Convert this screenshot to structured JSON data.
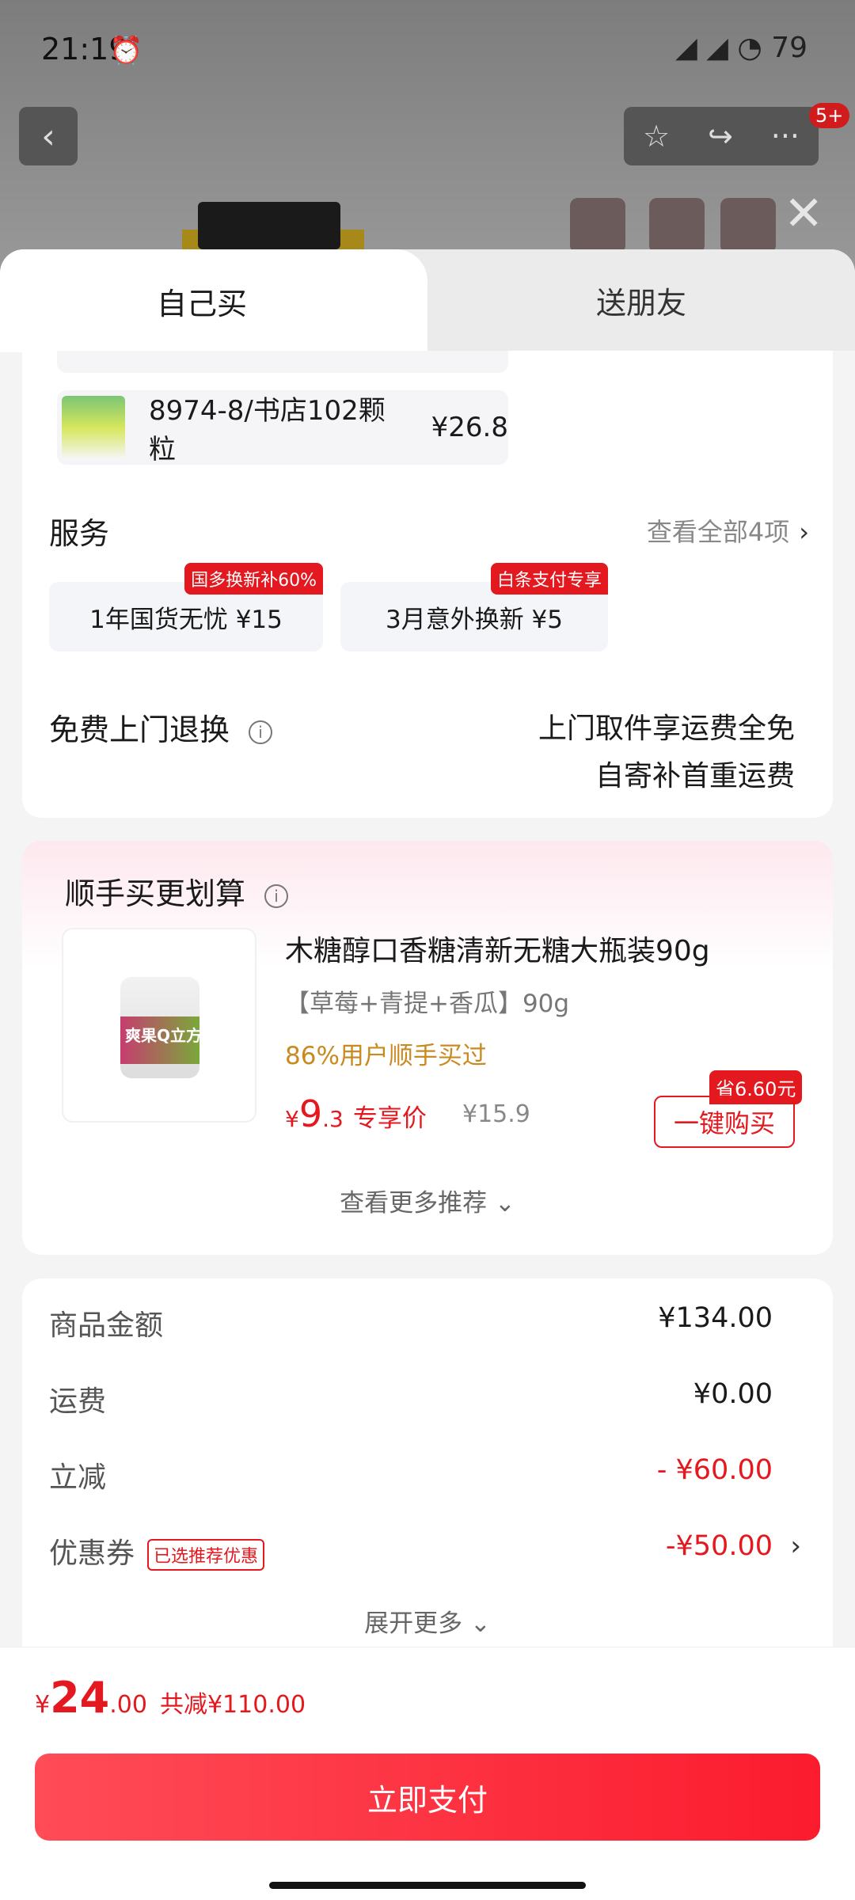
{
  "status_bar": {
    "time": "21:19",
    "battery": "79"
  },
  "nav": {
    "back_icon": "‹",
    "star_icon": "☆",
    "share_icon": "↪",
    "more_icon": "···",
    "badge": "5+",
    "close_icon": "✕"
  },
  "tabs": {
    "self": "自己买",
    "gift": "送朋友"
  },
  "order_item": {
    "name": "8974-8/书店102颗粒",
    "price": "¥26.8"
  },
  "services": {
    "title": "服务",
    "more": "查看全部4项",
    "items": [
      {
        "label": "1年国货无忧  ¥15",
        "tag": "国多换新补60%"
      },
      {
        "label": "3月意外换新  ¥5",
        "tag": "白条支付专享"
      }
    ]
  },
  "returns": {
    "title": "免费上门退换",
    "line1": "上门取件享运费全免",
    "line2": "自寄补首重运费"
  },
  "recommend": {
    "title": "顺手买更划算",
    "product_name": "木糖醇口香糖清新无糖大瓶装90g",
    "spec": "【草莓+青提+香瓜】90g",
    "social": "86%用户顺手买过",
    "price_int": "9",
    "price_dec": ".3",
    "price_label": "专享价",
    "orig_price": "¥15.9",
    "save": "省6.60元",
    "buy": "一键购买",
    "more": "查看更多推荐 ⌄",
    "jar_text": "爽果Q立方"
  },
  "summary": {
    "rows": [
      {
        "label": "商品金额",
        "value": "¥134.00"
      },
      {
        "label": "运费",
        "value": "¥0.00"
      },
      {
        "label": "立减",
        "value": "- ¥60.00"
      },
      {
        "label": "优惠券",
        "value": "-¥50.00",
        "tag": "已选推荐优惠"
      }
    ],
    "expand": "展开更多 ⌄"
  },
  "footer": {
    "yen": "¥",
    "total_int": "24",
    "total_dec": ".00",
    "saved": "共减¥110.00",
    "pay": "立即支付"
  }
}
